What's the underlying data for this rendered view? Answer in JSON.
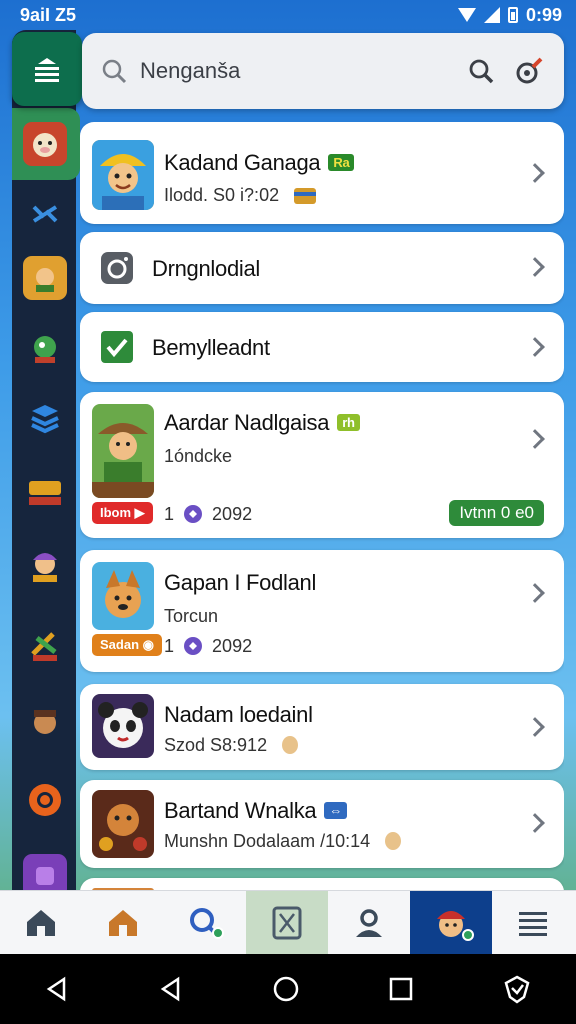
{
  "status_bar": {
    "left": "9aiI Z5",
    "time": "0:99"
  },
  "search": {
    "placeholder": "Nenganša"
  },
  "items": [
    {
      "title": "Kadand Ganaga",
      "tag": "Ra",
      "subtitle": "Ilodd. S0 i?:02"
    },
    {
      "title": "Drngnlodial"
    },
    {
      "title": "Bemylleadnt"
    },
    {
      "title": "Aardar Nadlgaisa",
      "tag": "rh",
      "subtitle": "1óndcke",
      "pill": "Ibom",
      "count": "1",
      "date": "2092",
      "badge": "Ivtnn 0 e0"
    },
    {
      "title": "Gapan I Fodlanl",
      "subtitle": "Torcun",
      "pill": "Sadan",
      "count": "1",
      "date": "2092"
    },
    {
      "title": "Nadam loedainl",
      "subtitle": "Szod S8:912"
    },
    {
      "title": "Bartand Wnalka",
      "tag": "⇔",
      "subtitle": "Munshn Dodalaam /10:14"
    }
  ],
  "colors": {
    "rail": "#16253d",
    "accent_green": "#0d6e4d",
    "nav_blue": "#0d3f8c"
  }
}
